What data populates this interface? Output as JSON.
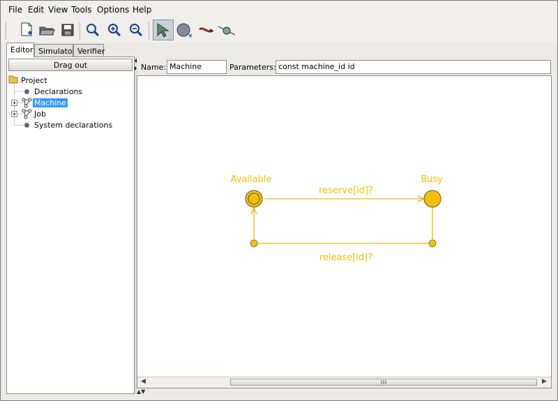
{
  "menu": [
    "File",
    "Edit",
    "View",
    "Tools",
    "Options",
    "Help"
  ],
  "toolbar": {
    "buttons": [
      "new-document-icon",
      "open-folder-icon",
      "save-icon",
      "zoom-to-fit-icon",
      "zoom-in-icon",
      "zoom-out-icon",
      "select-tool-icon",
      "add-location-icon",
      "add-edge-icon",
      "add-nail-icon"
    ]
  },
  "tabs": [
    "Editor",
    "Simulator",
    "Verifier"
  ],
  "sidebar": {
    "drag_out": "Drag out",
    "tree": {
      "root": "Project",
      "items": [
        "Declarations",
        "Machine",
        "Job",
        "System declarations"
      ],
      "selected": "Machine"
    }
  },
  "template": {
    "name_label": "Name:",
    "name_value": "Machine",
    "params_label": "Parameters:",
    "params_value": "const machine_id id"
  },
  "automaton": {
    "locations": [
      {
        "name": "Available",
        "initial": true
      },
      {
        "name": "Busy",
        "initial": false
      }
    ],
    "edges": [
      {
        "from": "Available",
        "to": "Busy",
        "label": "reserve[id]?"
      },
      {
        "from": "Busy",
        "to": "Available",
        "label": "release[id]?"
      }
    ],
    "color": "#f5b800",
    "label_color": "#f0c000"
  }
}
